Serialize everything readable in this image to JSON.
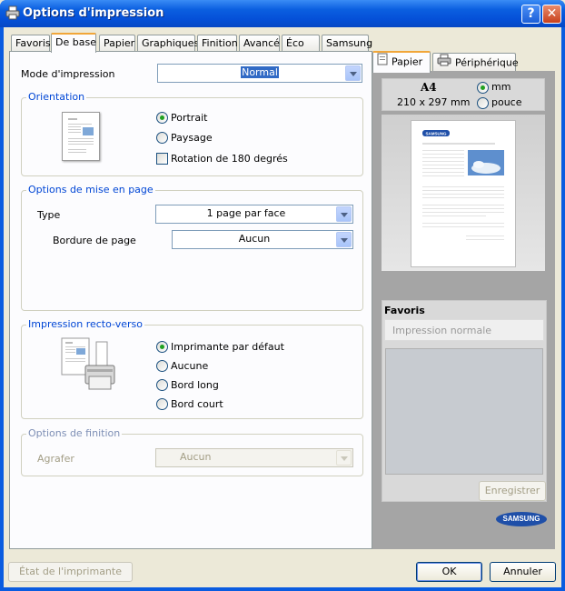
{
  "window": {
    "title": "Options d'impression",
    "help_label": "?",
    "close_label": "✕"
  },
  "tabs": [
    {
      "label": "Favoris"
    },
    {
      "label": "De base"
    },
    {
      "label": "Papier"
    },
    {
      "label": "Graphiques"
    },
    {
      "label": "Finition"
    },
    {
      "label": "Avancé"
    },
    {
      "label": "Éco"
    },
    {
      "label": "Samsung"
    }
  ],
  "mode": {
    "label": "Mode d'impression",
    "value": "Normal"
  },
  "orientation": {
    "title": "Orientation",
    "options": [
      "Portrait",
      "Paysage"
    ],
    "selected": "Portrait",
    "rotation_label": "Rotation de 180 degrés",
    "rotation_checked": false
  },
  "layout": {
    "title": "Options de mise en page",
    "type_label": "Type",
    "type_value": "1 page par face",
    "border_label": "Bordure de page",
    "border_value": "Aucun"
  },
  "duplex": {
    "title": "Impression recto-verso",
    "options": [
      "Imprimante par défaut",
      "Aucune",
      "Bord long",
      "Bord court"
    ],
    "selected": "Imprimante par défaut"
  },
  "finishing": {
    "title": "Options de finition",
    "staple_label": "Agrafer",
    "staple_value": "Aucun"
  },
  "preview": {
    "tabs": [
      "Papier",
      "Périphérique"
    ],
    "paper_size": "A4",
    "paper_dims": "210 x 297 mm",
    "units": [
      "mm",
      "pouce"
    ],
    "selected_unit": "mm",
    "logo_text": "SAMSUNG"
  },
  "favorites": {
    "title": "Favoris",
    "placeholder": "Impression normale",
    "save_label": "Enregistrer"
  },
  "footer": {
    "printer_status_label": "État de l'imprimante",
    "ok_label": "OK",
    "cancel_label": "Annuler"
  },
  "brand_logo": "SAMSUNG",
  "colors": {
    "title_bar": "#0b5fe0",
    "accent_tab": "#f1a639",
    "group_title": "#0046d5",
    "selection": "#316ac5"
  }
}
